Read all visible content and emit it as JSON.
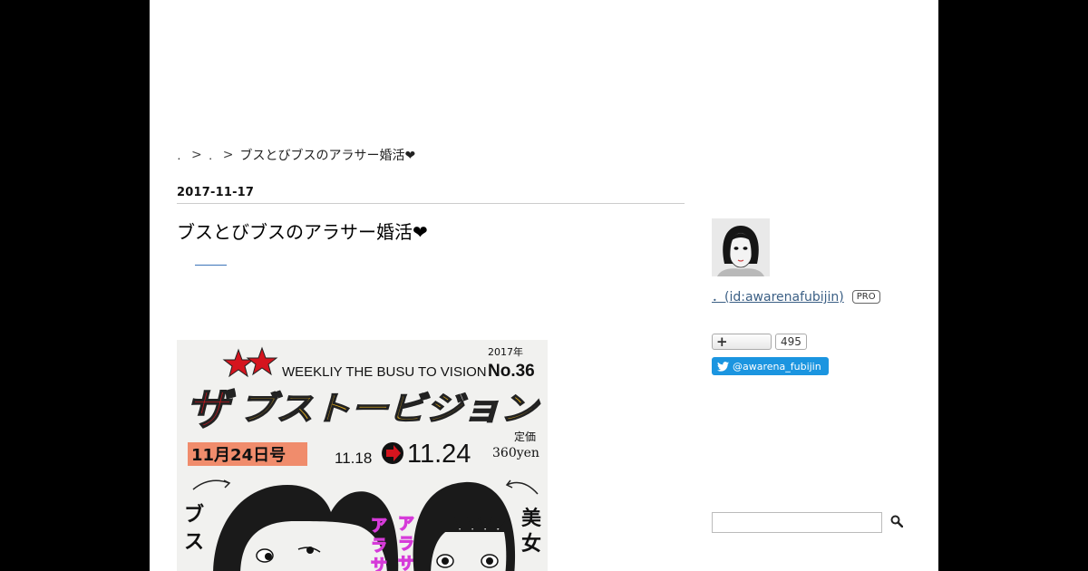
{
  "breadcrumb": {
    "items": [
      "．",
      "．"
    ],
    "separator": ">",
    "current": "ブスとびブスのアラサー婚活❤"
  },
  "article": {
    "date": "2017-11-17",
    "title": "ブスとびブスのアラサー婚活❤"
  },
  "eyecatch": {
    "year": "2017年",
    "magazine_en": "WEEKLIY THE BUSU TO VISION",
    "issue_no": "No.36",
    "magazine_title": "ザブストービジョン",
    "price_label": "定価",
    "price": "360yen",
    "issue_date": "11月24日号",
    "range_from": "11.18",
    "range_to": "11.24",
    "left_label": "ブス",
    "right_label": "美女",
    "center_label_1": "アラサー",
    "center_label_2": "アラサー"
  },
  "profile": {
    "id_link": "．(id:awarenafubijin)",
    "badge": "PRO",
    "subscribe_count": "495",
    "twitter_handle": "@awarena_fubijin"
  },
  "search": {
    "placeholder": ""
  },
  "colors": {
    "outer_bg": "#000000",
    "link": "#3b5f85",
    "twitter": "#1b95e0",
    "cover_yellow": "#e6b11e",
    "cover_red": "#d5141e",
    "date_box": "#f08c6c",
    "pink_text": "#d63bd9"
  },
  "icons": [
    "plus-icon",
    "twitter-bird-icon",
    "search-icon"
  ]
}
